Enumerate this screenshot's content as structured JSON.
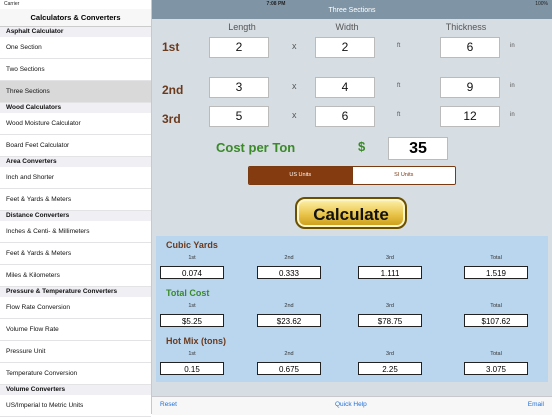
{
  "status": {
    "carrier": "Carrier",
    "time": "7:08 PM",
    "battery": "100%"
  },
  "sidebar": {
    "title": "Calculators & Converters",
    "sections": [
      {
        "header": "Asphalt Calculator",
        "items": [
          "One Section",
          "Two Sections",
          "Three Sections"
        ]
      },
      {
        "header": "Wood Calculators",
        "items": [
          "Wood Moisture Calculator",
          "Board Feet Calculator"
        ]
      },
      {
        "header": "Area Converters",
        "items": [
          "Inch and Shorter",
          "Feet & Yards & Meters"
        ]
      },
      {
        "header": "Distance Converters",
        "items": [
          "Inches & Centi- & Millimeters",
          "Feet & Yards & Meters",
          "Miles & Kilometers"
        ]
      },
      {
        "header": "Pressure & Temperature Converters",
        "items": [
          "Flow Rate Conversion",
          "Volume Flow Rate",
          "Pressure Unit",
          "Temperature Conversion"
        ]
      },
      {
        "header": "Volume Converters",
        "items": [
          "US/Imperial to Metric Units"
        ]
      }
    ],
    "selected": "Three Sections"
  },
  "main": {
    "title": "Three Sections",
    "columns": {
      "length": "Length",
      "width": "Width",
      "thickness": "Thickness"
    },
    "x_symbol": "x",
    "unit_ft": "ft",
    "unit_in": "in",
    "rows": [
      {
        "label": "1st",
        "length": "2",
        "width": "2",
        "thickness": "6"
      },
      {
        "label": "2nd",
        "length": "3",
        "width": "4",
        "thickness": "9"
      },
      {
        "label": "3rd",
        "length": "5",
        "width": "6",
        "thickness": "12"
      }
    ],
    "cost_label": "Cost per Ton",
    "currency": "$",
    "cost_value": "35",
    "units": {
      "us": "US Units",
      "si": "SI Units",
      "selected": "us"
    },
    "calculate_label": "Calculate",
    "results": [
      {
        "title": "Cubic Yards",
        "color": "#6b3a1d",
        "cols": [
          "1st",
          "2nd",
          "3rd",
          "Total"
        ],
        "values": [
          "0.074",
          "0.333",
          "1.111",
          "1.519"
        ]
      },
      {
        "title": "Total Cost",
        "color": "#3a8a28",
        "cols": [
          "1st",
          "2nd",
          "3rd",
          "Total"
        ],
        "values": [
          "$5.25",
          "$23.62",
          "$78.75",
          "$107.62"
        ]
      },
      {
        "title": "Hot Mix (tons)",
        "color": "#6b3a1d",
        "cols": [
          "1st",
          "2nd",
          "3rd",
          "Total"
        ],
        "values": [
          "0.15",
          "0.675",
          "2.25",
          "3.075"
        ]
      }
    ],
    "footer": {
      "reset": "Reset",
      "help": "Quick Help",
      "email": "Email"
    }
  }
}
